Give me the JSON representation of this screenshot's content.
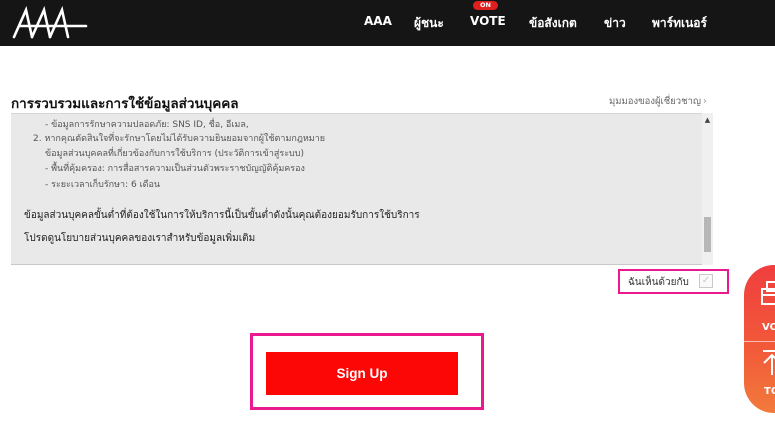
{
  "nav": {
    "items": [
      {
        "label": "AAA"
      },
      {
        "label": "ผู้ชนะ"
      },
      {
        "label": "VOTE",
        "badge": "ON"
      },
      {
        "label": "ข้อสังเกต"
      },
      {
        "label": "ข่าว"
      },
      {
        "label": "พาร์ทเนอร์"
      }
    ]
  },
  "section": {
    "title": "การรวบรวมและการใช้ข้อมูลส่วนบุคคล",
    "expert_link": "มุมมองของผู้เชี่ยวชาญ",
    "expert_link_icon": "chevron-right-icon"
  },
  "terms": {
    "lines": [
      "- ข้อมูลการรักษาความปลอดภัย: SNS ID, ชื่อ, อีเมล,",
      "2. หากคุณตัดสินใจที่จะรักษาโดยไม่ได้รับความยินยอมจากผู้ใช้ตามกฎหมาย",
      "ข้อมูลส่วนบุคคลที่เกี่ยวข้องกับการใช้บริการ (ประวัติการเข้าสู่ระบบ)",
      "- พื้นที่คุ้มครอง: การสื่อสารความเป็นส่วนตัวพระราชบัญญัติคุ้มครอง",
      "- ระยะเวลาเก็บรักษา: 6 เดือน"
    ],
    "paragraph1": "ข้อมูลส่วนบุคคลขั้นต่ำที่ต้องใช้ในการให้บริการนี้เป็นขั้นต่ำดังนั้นคุณต้องยอมรับการใช้บริการ",
    "paragraph2": "โปรดดูนโยบายส่วนบุคคลของเราสำหรับข้อมูลเพิ่มเติม"
  },
  "agree": {
    "label": "ฉันเห็นด้วยกับ",
    "checked": false,
    "check_glyph": "✓"
  },
  "signup": {
    "label": "Sign Up"
  },
  "side_float": {
    "vote_label": "VO",
    "top_label": "TO",
    "vote_icon": "ballot-box-icon",
    "top_icon": "arrow-up-icon"
  },
  "colors": {
    "nav_bg": "#151515",
    "signup_button": "#fc0606",
    "highlight_border": "#ea1a8e",
    "on_badge": "#e01f1f",
    "side_float_top": "#f03e3e",
    "side_float_bottom": "#f27a3b"
  }
}
